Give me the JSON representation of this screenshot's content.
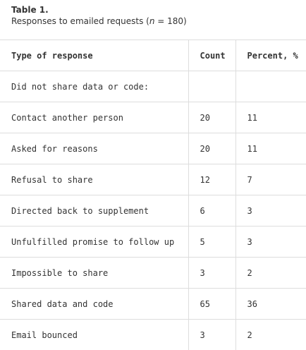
{
  "caption": {
    "label": "Table 1.",
    "subtitle_prefix": "Responses to emailed requests (",
    "subtitle_n": "n",
    "subtitle_suffix": " = 180)"
  },
  "table": {
    "headers": [
      "Type of response",
      "Count",
      "Percent, %"
    ],
    "rows": [
      [
        "Did not share data or code:",
        "",
        ""
      ],
      [
        "Contact another person",
        "20",
        "11"
      ],
      [
        "Asked for reasons",
        "20",
        "11"
      ],
      [
        "Refusal to share",
        "12",
        "7"
      ],
      [
        "Directed back to supplement",
        "6",
        "3"
      ],
      [
        "Unfulfilled promise to follow up",
        "5",
        "3"
      ],
      [
        "Impossible to share",
        "3",
        "2"
      ],
      [
        "Shared data and code",
        "65",
        "36"
      ],
      [
        "Email bounced",
        "3",
        "2"
      ]
    ]
  }
}
